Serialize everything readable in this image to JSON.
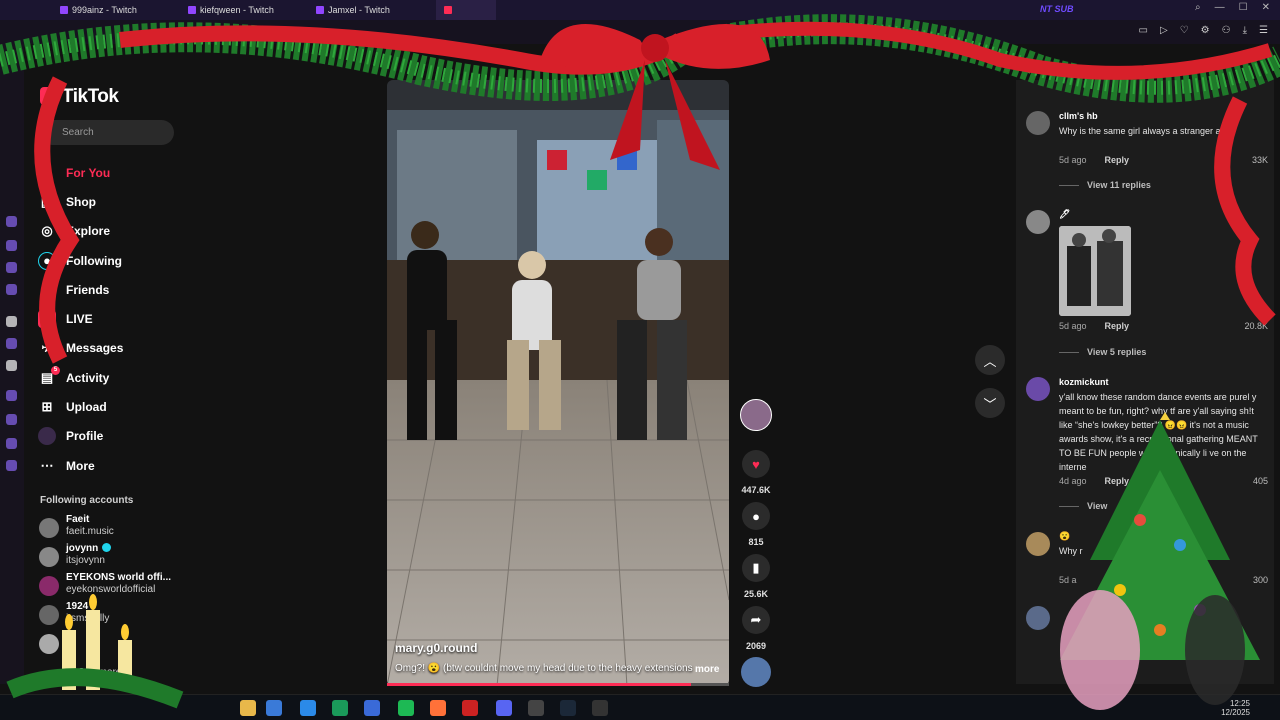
{
  "browser": {
    "tabs": [
      {
        "label": "999ainz - Twitch"
      },
      {
        "label": "kiefqween - Twitch"
      },
      {
        "label": "Jamxel - Twitch"
      }
    ],
    "brand_tag": "NT SUB"
  },
  "tiktok": {
    "logo": "TikTok",
    "search_placeholder": "Search",
    "nav": [
      {
        "label": "For You",
        "icon": "home-icon",
        "active": true
      },
      {
        "label": "Shop",
        "icon": "bag-icon"
      },
      {
        "label": "Explore",
        "icon": "compass-icon"
      },
      {
        "label": "Following",
        "icon": "following-icon"
      },
      {
        "label": "Friends",
        "icon": "friends-icon"
      },
      {
        "label": "LIVE",
        "icon": "live-icon"
      },
      {
        "label": "Messages",
        "icon": "message-icon"
      },
      {
        "label": "Activity",
        "icon": "activity-icon",
        "badge": "5"
      },
      {
        "label": "Upload",
        "icon": "plus-square-icon"
      },
      {
        "label": "Profile",
        "icon": "avatar-icon"
      },
      {
        "label": "More",
        "icon": "ellipsis-icon"
      }
    ],
    "following_title": "Following accounts",
    "following": [
      {
        "name": "Faeit",
        "handle": "faeit.music"
      },
      {
        "name": "jovynn",
        "handle": "itsjovynn",
        "verified": true
      },
      {
        "name": "EYEKONS world offi...",
        "handle": "eyekonsworldofficial"
      },
      {
        "name": "1924",
        "handle": "itsmskelly"
      },
      {
        "name": "B",
        "handle": ""
      },
      {
        "name": "See more",
        "handle": ""
      }
    ]
  },
  "video": {
    "username": "mary.g0.round",
    "caption": "Omg?! 😮 (btw couldnt move my head due to the heavy extensions",
    "more": "more",
    "progress": 0.89,
    "likes": "447.6K",
    "comments": "815",
    "saves": "25.6K",
    "shares": "2069"
  },
  "comments": [
    {
      "user": "cllm's hb",
      "text": "Why is the same girl always a stranger ating",
      "age": "5d ago",
      "reply": "Reply",
      "likes": "33K",
      "view_replies": "View 11 replies"
    },
    {
      "user": "🖊",
      "text": "",
      "age": "5d ago",
      "reply": "Reply",
      "likes": "20.8K",
      "view_replies": "View 5 replies"
    },
    {
      "user": "kozmickunt",
      "text": "y'all know these random dance events are purel y meant to be fun, right? why tf are y'all saying sh!t like “she's lowkey better”? 😠😠 it's not a music awards show, it's a recreational gathering MEANT TO BE FUN people who chronically li ve on the interne",
      "age": "4d ago",
      "reply": "Reply",
      "likes": "405",
      "view_replies": "View"
    },
    {
      "user": "😮",
      "text": "Why r",
      "age": "5d a",
      "reply": "",
      "likes": "300",
      "view_replies": ""
    }
  ],
  "taskbar": {
    "time": "12:25",
    "date": "12/2025"
  },
  "colors": {
    "accent": "#fe2c55",
    "panel": "#1c1c1c",
    "bg": "#121212"
  }
}
